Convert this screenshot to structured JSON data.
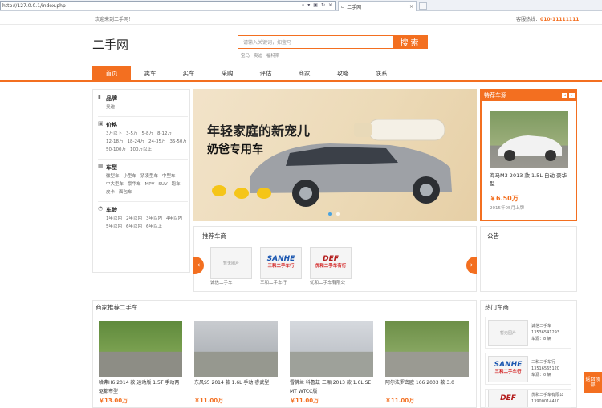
{
  "browser": {
    "url": "http://127.0.0.1/index.php",
    "tab_title": "二手网"
  },
  "topbar": {
    "welcome": "欢迎来到二手网！",
    "hotline_label": "客服热线：",
    "hotline_number": "010-11111111"
  },
  "header": {
    "logo": "二手网",
    "search_placeholder": "请输入关键词，如宝马",
    "search_button": "搜索",
    "hot_words": [
      "宝马",
      "奥迪",
      "福特斯"
    ]
  },
  "nav": [
    "首页",
    "卖车",
    "买车",
    "采购",
    "评估",
    "商家",
    "攻略",
    "联系"
  ],
  "filter": {
    "groups": [
      {
        "title": "品牌",
        "icon": "bookmark-icon",
        "options": [
          "奥迪"
        ]
      },
      {
        "title": "价格",
        "icon": "price-tag-icon",
        "options": [
          "3万以下",
          "3-5万",
          "5-8万",
          "8-12万",
          "12-18万",
          "18-24万",
          "24-35万",
          "35-50万",
          "50-100万",
          "100万以上"
        ]
      },
      {
        "title": "车型",
        "icon": "car-type-icon",
        "options": [
          "微型车",
          "小型车",
          "紧凑型车",
          "中型车",
          "中大型车",
          "豪华车",
          "MPV",
          "SUV",
          "跑车",
          "皮卡",
          "面包车"
        ]
      },
      {
        "title": "车龄",
        "icon": "clock-icon",
        "options": [
          "1年以内",
          "2年以内",
          "3年以内",
          "4年以内",
          "5年以内",
          "6年以内",
          "6年以上"
        ]
      }
    ]
  },
  "banner": {
    "line1": "年轻家庭的新宠儿",
    "line2": "奶爸专用车"
  },
  "special": {
    "title": "特荐车源",
    "car_title": "海马M3 2013 款 1.5L 自动 豪华型",
    "price": "￥6.50万",
    "date": "2015年05月上牌"
  },
  "dealers": {
    "title": "推荐车商",
    "items": [
      {
        "logo_text": "暂无图片",
        "name": "诚信二手车"
      },
      {
        "logo_text": "SANHE",
        "logo_sub": "三和二手车行",
        "name": "三和二手车行"
      },
      {
        "logo_text": "DEF",
        "logo_sub": "优和二手车有行",
        "name": "优和二手车有限公"
      }
    ]
  },
  "notice": {
    "title": "公告"
  },
  "merchant_cars": {
    "title": "商家推荐二手车",
    "items": [
      {
        "title": "哈弗H6 2014 款 运动版 1.5T 手动两驱都市型",
        "price": "￥13.00万"
      },
      {
        "title": "东风S5 2014 款 1.6L 手动 睿武型",
        "price": "￥11.00万"
      },
      {
        "title": "雪佛兰 科鲁兹 三厢 2013 款 1.6L SE MT WTCC版",
        "price": "￥11.00万"
      },
      {
        "title": "阿尔法罗密欧 166 2003 款 3.0",
        "price": "￥11.00万"
      }
    ]
  },
  "hot_dealers": {
    "title": "热门车商",
    "items": [
      {
        "logo_text": "暂无图片",
        "name": "诚信二手车",
        "phone": "13536541293",
        "count": "车源：8 辆"
      },
      {
        "logo_text": "SANHE",
        "logo_sub": "三和二手车行",
        "name": "三和二手车行",
        "phone": "13516565120",
        "count": "车源：0 辆"
      },
      {
        "logo_text": "DEF",
        "name": "优和二手车有限公",
        "phone": "13900014410",
        "count": ""
      }
    ]
  },
  "feedback": "返回顶部"
}
